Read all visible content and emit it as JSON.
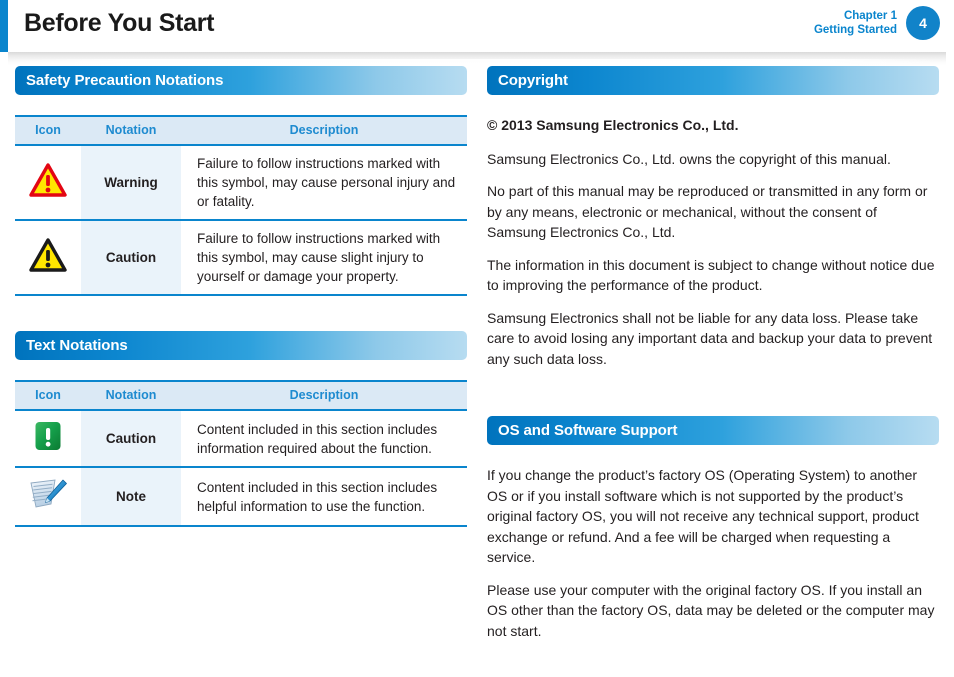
{
  "header": {
    "title": "Before You Start",
    "chapter_line1": "Chapter 1",
    "chapter_line2": "Getting Started",
    "page_number": "4",
    "accent_color": "#0a85cd"
  },
  "left_column": {
    "section_safety": {
      "title": "Safety Precaution Notations",
      "table": {
        "columns": [
          "Icon",
          "Notation",
          "Description"
        ],
        "rows": [
          {
            "icon": "warning-triangle-red-icon",
            "notation": "Warning",
            "description": "Failure to follow instructions marked with this symbol, may cause personal injury and or fatality."
          },
          {
            "icon": "caution-triangle-black-icon",
            "notation": "Caution",
            "description": "Failure to follow instructions marked with this symbol, may cause slight injury to yourself or damage your property."
          }
        ]
      }
    },
    "section_text_notations": {
      "title": "Text Notations",
      "table": {
        "columns": [
          "Icon",
          "Notation",
          "Description"
        ],
        "rows": [
          {
            "icon": "caution-green-exclamation-icon",
            "notation": "Caution",
            "description": "Content included in this section includes information required about the function."
          },
          {
            "icon": "note-paper-pen-icon",
            "notation": "Note",
            "description": "Content included in this section includes helpful information to use the function."
          }
        ]
      }
    }
  },
  "right_column": {
    "section_copyright": {
      "title": "Copyright",
      "paragraphs": [
        "© 2013 Samsung Electronics Co., Ltd.",
        "Samsung Electronics Co., Ltd. owns the copyright of this manual.",
        "No part of this manual may be reproduced or transmitted in any form or by any means, electronic or mechanical, without the consent of Samsung Electronics Co., Ltd.",
        "The information in this document is subject to change without notice due to improving the performance of the product.",
        "Samsung Electronics shall not be liable for any data loss. Please take care to avoid losing any important data and backup your data to prevent any such data loss."
      ]
    },
    "section_os_support": {
      "title": "OS and Software Support",
      "paragraphs": [
        "If you change the product’s factory OS (Operating System) to another OS or if you install software which is not supported by the product’s original factory OS, you will not receive any technical support, product exchange or refund. And a fee will be charged when requesting a service.",
        "Please use your computer with the original factory OS. If you install an OS other than the factory OS, data may be deleted or the computer may not start."
      ]
    }
  },
  "colors": {
    "brand_blue": "#0a85cd",
    "header_row_bg": "#dbe9f5",
    "notation_cell_bg": "#eaf3fa",
    "warning_red": "#e30613",
    "warning_yellow": "#ffe600",
    "caution_green": "#169b48",
    "text_black": "#231f20"
  }
}
